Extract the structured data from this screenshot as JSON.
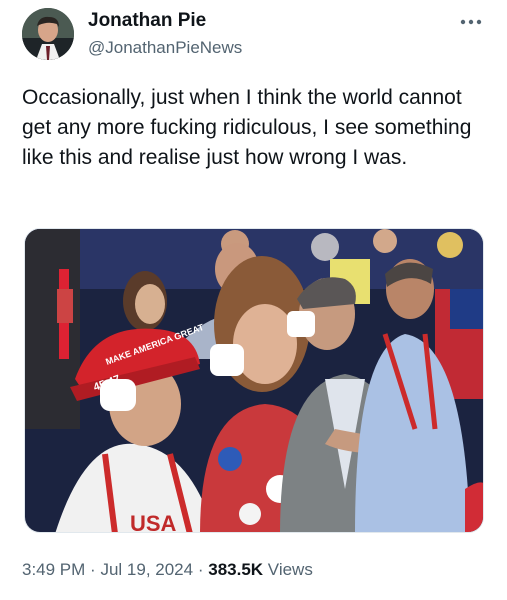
{
  "author": {
    "name": "Jonathan Pie",
    "handle": "@JonathanPieNews"
  },
  "tweet": {
    "text": "Occasionally, just when I think the world cannot get any more fucking ridiculous, I see something like this and realise just how wrong I was."
  },
  "photo": {
    "hat_text": "MAKE AMERICA GREAT",
    "hat_number": "45.47",
    "shirt_text": "USA"
  },
  "meta": {
    "time": "3:49 PM",
    "separator": "·",
    "date": "Jul 19, 2024",
    "views_count": "383.5K",
    "views_label": "Views"
  },
  "icons": {
    "more": "more-options-icon"
  }
}
